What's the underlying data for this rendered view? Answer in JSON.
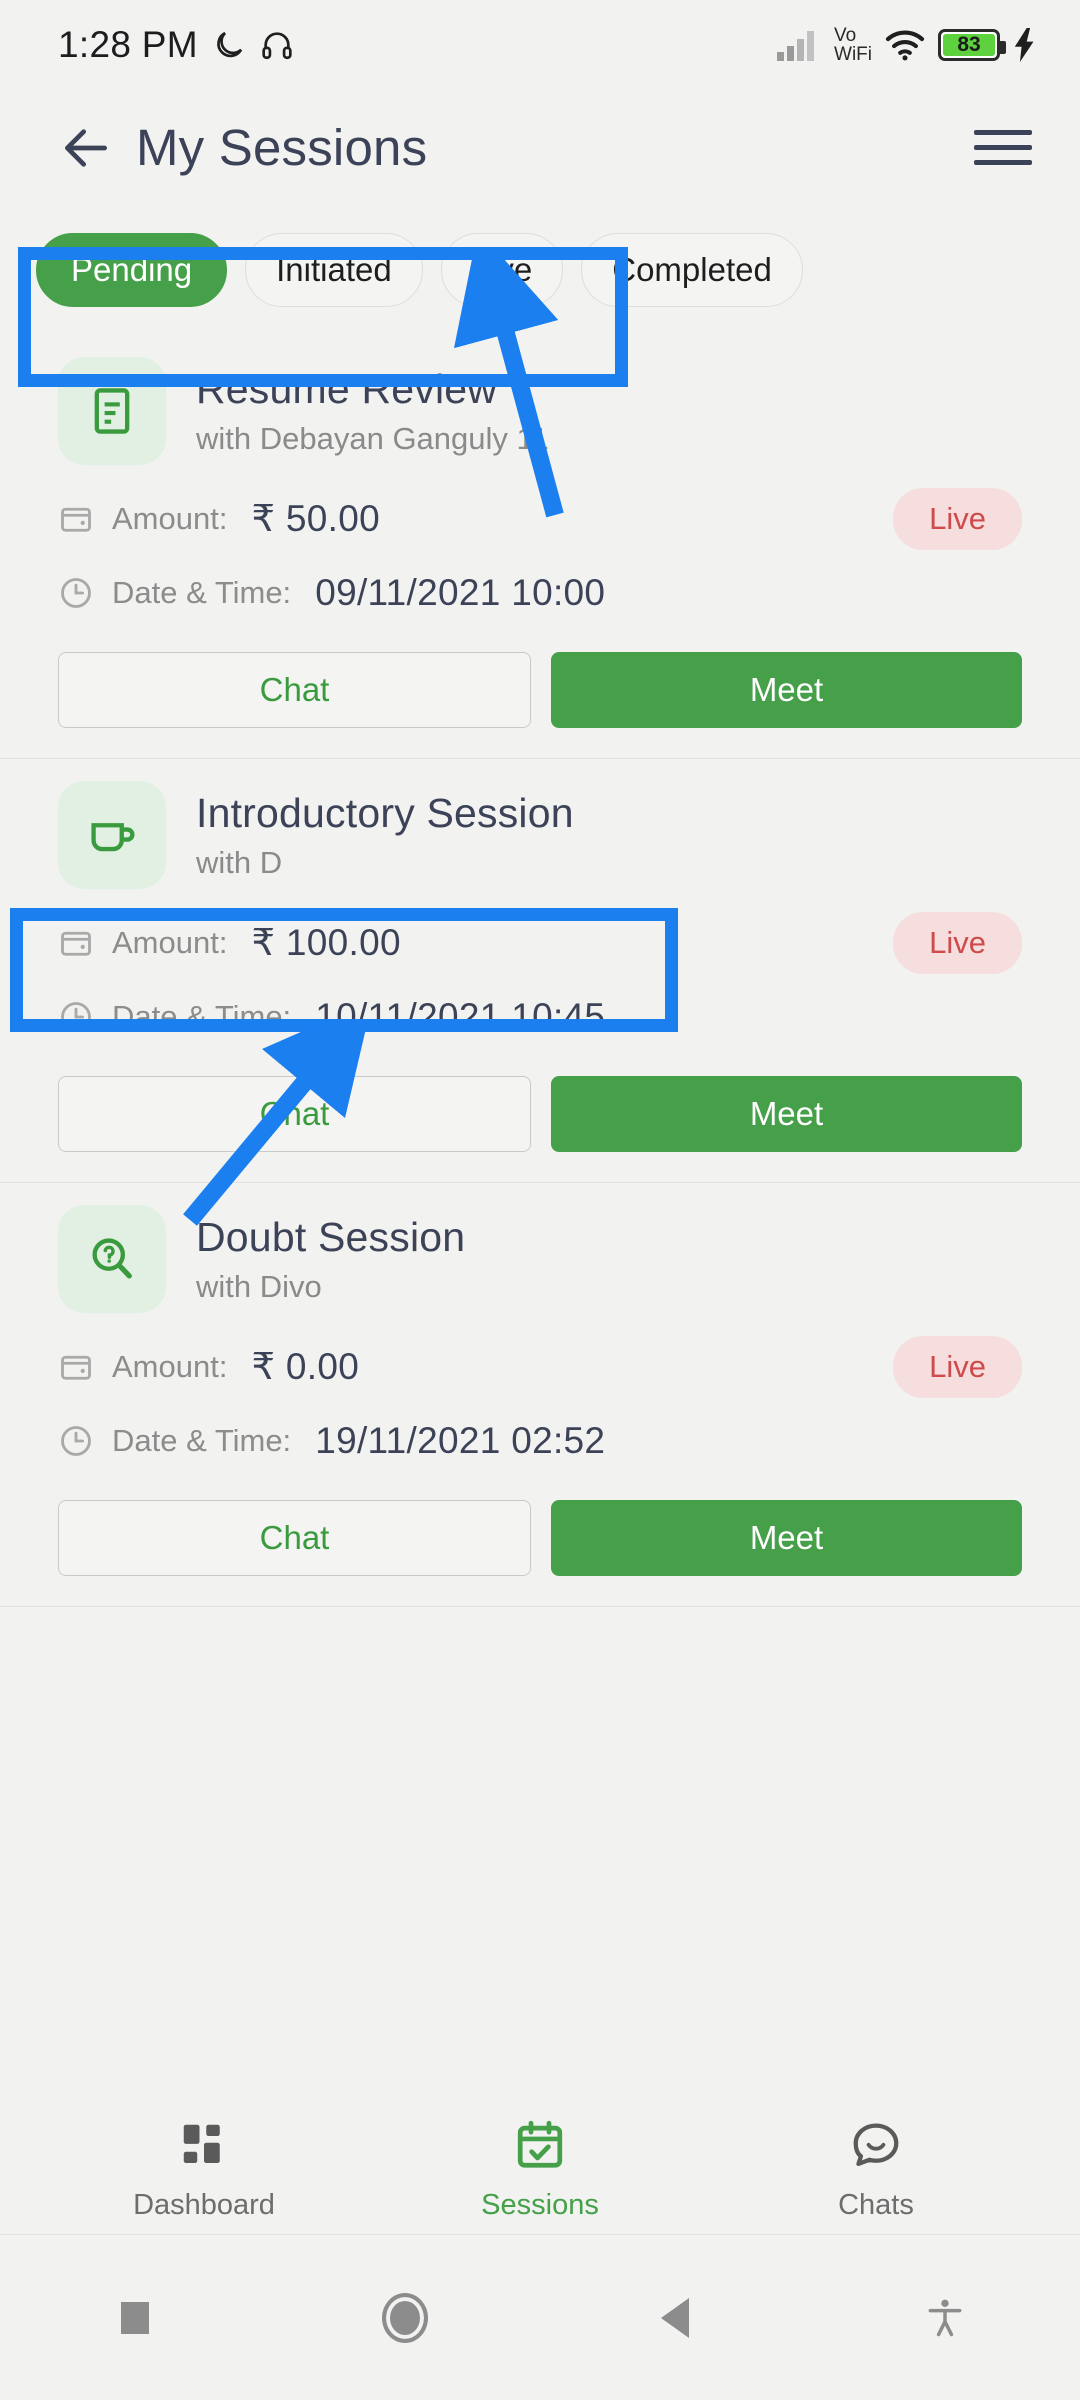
{
  "status_bar": {
    "time": "1:28 PM",
    "left_icons": [
      "moon-icon",
      "headphones-icon"
    ],
    "network_label": "Vo",
    "network_label2": "WiFi",
    "battery_level": "83",
    "right_icons": [
      "signal-bars-icon",
      "vowifi-icon",
      "wifi-icon",
      "battery-icon",
      "charging-bolt-icon"
    ]
  },
  "app_bar": {
    "back_icon": "back-arrow-icon",
    "title": "My Sessions",
    "menu_icon": "hamburger-menu-icon"
  },
  "tabs": [
    {
      "label": "Pending",
      "active": true
    },
    {
      "label": "Initiated",
      "active": false
    },
    {
      "label": "Live",
      "active": false
    },
    {
      "label": "Completed",
      "active": false
    }
  ],
  "labels": {
    "amount": "Amount:",
    "datetime": "Date & Time:",
    "chat": "Chat",
    "meet": "Meet"
  },
  "sessions": [
    {
      "icon": "document-icon",
      "title": "Resume Review",
      "subtitle": "with Debayan Ganguly 11",
      "amount": "₹ 50.00",
      "datetime": "09/11/2021 10:00",
      "status": "Live"
    },
    {
      "icon": "coffee-cup-icon",
      "title": "Introductory Session",
      "subtitle": "with D",
      "amount": "₹ 100.00",
      "datetime": "10/11/2021 10:45",
      "status": "Live"
    },
    {
      "icon": "question-search-icon",
      "title": "Doubt Session",
      "subtitle": "with Divo",
      "amount": "₹ 0.00",
      "datetime": "19/11/2021 02:52",
      "status": "Live"
    }
  ],
  "bottom_nav": [
    {
      "label": "Dashboard",
      "icon": "grid-dashboard-icon",
      "active": false
    },
    {
      "label": "Sessions",
      "icon": "calendar-check-icon",
      "active": true
    },
    {
      "label": "Chats",
      "icon": "chat-bubble-icon",
      "active": false
    }
  ],
  "system_nav": [
    {
      "icon": "recents-square-icon"
    },
    {
      "icon": "home-circle-icon"
    },
    {
      "icon": "back-triangle-icon"
    },
    {
      "icon": "accessibility-icon"
    }
  ],
  "colors": {
    "accent_green": "#45a049",
    "annotation_blue": "#1b7ff0",
    "status_red": "#cf4b4b",
    "status_red_bg": "#f6dede",
    "background": "#f2f2f0"
  }
}
